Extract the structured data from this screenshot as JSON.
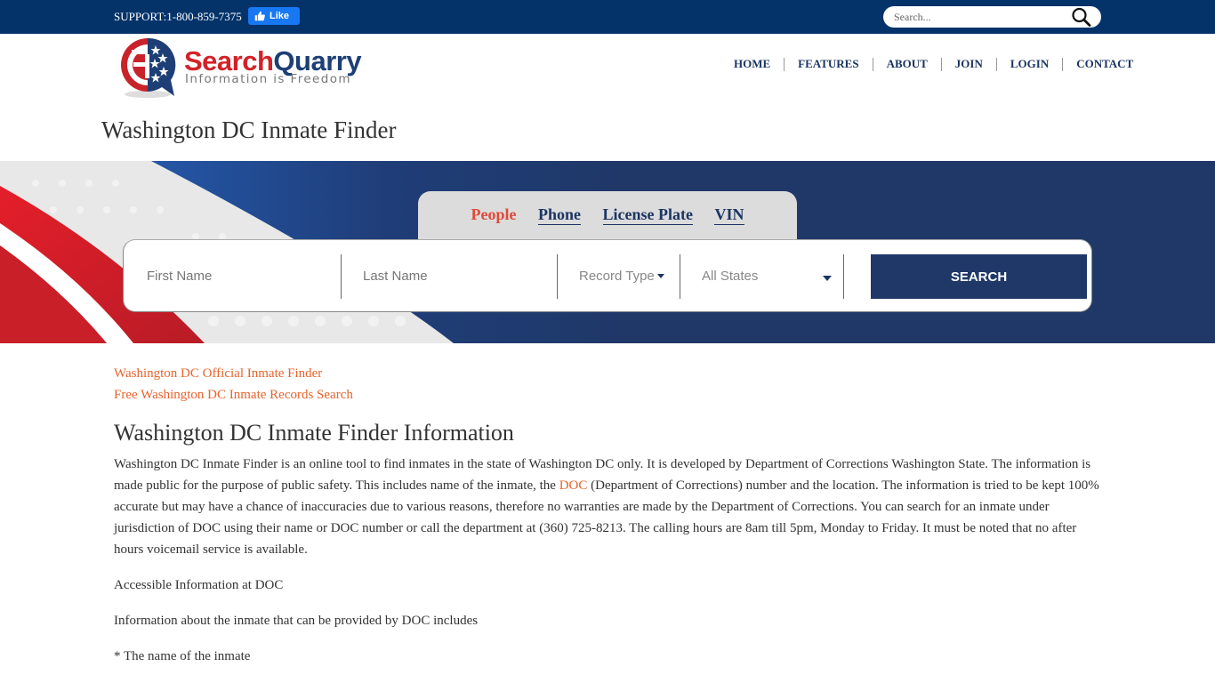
{
  "topbar": {
    "support": "SUPPORT:1-800-859-7375",
    "like_label": "Like",
    "search_placeholder": "Search..."
  },
  "logo": {
    "name_part1": "Search",
    "name_part2": "Quarry",
    "tagline": "Information is Freedom"
  },
  "nav": {
    "items": [
      "HOME",
      "FEATURES",
      "ABOUT",
      "JOIN",
      "LOGIN",
      "CONTACT"
    ]
  },
  "page_title": "Washington DC Inmate Finder",
  "search": {
    "tabs": [
      {
        "label": "People",
        "active": true
      },
      {
        "label": "Phone",
        "active": false
      },
      {
        "label": "License Plate",
        "active": false
      },
      {
        "label": "VIN",
        "active": false
      }
    ],
    "first_name_placeholder": "First Name",
    "last_name_placeholder": "Last Name",
    "record_type": "Record Type",
    "state": "All States",
    "button": "SEARCH"
  },
  "content": {
    "links": [
      "Washington DC Official Inmate Finder",
      "Free Washington DC Inmate Records Search"
    ],
    "heading": "Washington DC Inmate Finder Information",
    "para1_before": "Washington DC Inmate Finder is an online tool to find inmates in the state of Washington DC only. It is developed by Department of Corrections Washington State. The information is made public for the purpose of public safety. This includes name of the inmate, the ",
    "para1_link": "DOC",
    "para1_after": " (Department of Corrections) number and the location. The information is tried to be kept 100% accurate but may have a chance of inaccuracies due to various reasons, therefore no warranties are made by the Department of Corrections. You can search for an inmate under jurisdiction of DOC using their name or DOC number or call the department at (360) 725-8213. The calling hours are 8am till 5pm, Monday to Friday. It must be noted that no after hours voicemail service is available.",
    "para2": "Accessible Information at DOC",
    "para3": "Information about the inmate that can be provided by DOC includes",
    "para4": "* The name of the inmate"
  },
  "colors": {
    "topbar": "#04336a",
    "navy": "#1f3868",
    "accent_orange": "#e8632b",
    "active_tab": "#e04a3a",
    "logo_red": "#d32128",
    "logo_blue": "#1d3f75"
  }
}
